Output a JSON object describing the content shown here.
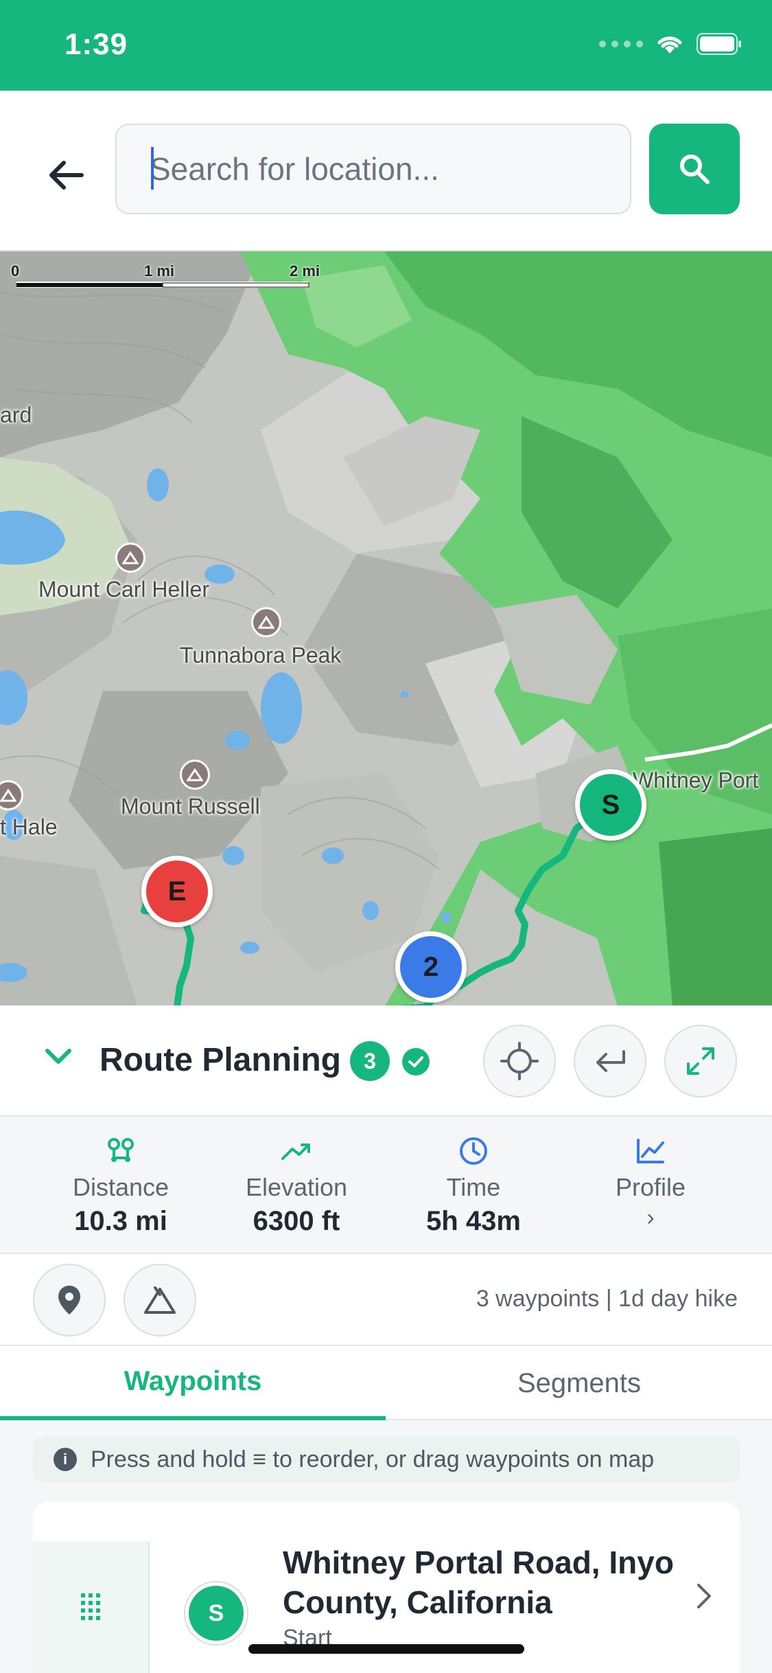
{
  "status_bar": {
    "time": "1:39",
    "icons": [
      "cellular-icon",
      "wifi-icon",
      "battery-icon"
    ]
  },
  "search": {
    "placeholder": "Search for location...",
    "value": ""
  },
  "map": {
    "scale": {
      "labels": [
        "0",
        "1 mi",
        "2 mi"
      ]
    },
    "labels": {
      "ard": "ard",
      "mount_carl_heller": "Mount Carl Heller",
      "tunnabora_peak": "Tunnabora Peak",
      "mount_russell": "Mount Russell",
      "t_hale": "t Hale",
      "whitney_portal": "Whitney Port"
    },
    "markers": {
      "start": "S",
      "end": "E",
      "mid": "2"
    }
  },
  "route": {
    "title": "Route Planning",
    "waypoint_count": "3"
  },
  "stats": [
    {
      "label": "Distance",
      "value": "10.3 mi",
      "icon": "route-icon"
    },
    {
      "label": "Elevation",
      "value": "6300 ft",
      "icon": "trend-up-icon"
    },
    {
      "label": "Time",
      "value": "5h 43m",
      "icon": "clock-icon"
    },
    {
      "label": "Profile",
      "value": "›",
      "icon": "chart-line-icon"
    }
  ],
  "tools": {
    "summary": "3 waypoints | 1d day hike"
  },
  "tabs": [
    {
      "label": "Waypoints",
      "active": true
    },
    {
      "label": "Segments",
      "active": false
    }
  ],
  "hint": {
    "text": "Press and hold ≡ to reorder, or drag waypoints on map"
  },
  "waypoints": [
    {
      "badge": "S",
      "name": "Whitney Portal Road, Inyo County, California",
      "subtitle": "Start"
    }
  ],
  "colors": {
    "accent": "#15b77e",
    "end_marker": "#e8403f",
    "mid_marker": "#3b7be8",
    "forest": "#5fc36c"
  }
}
